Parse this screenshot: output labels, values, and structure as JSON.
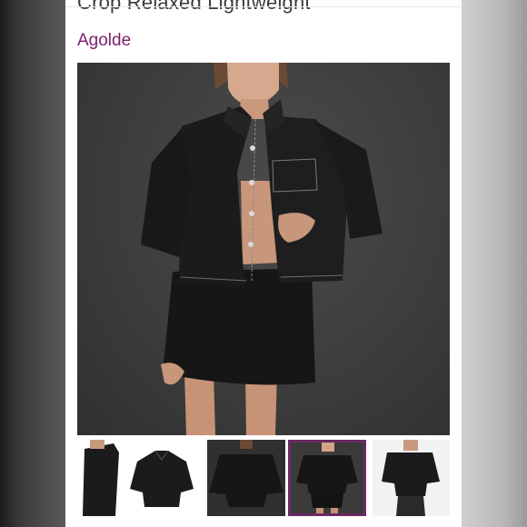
{
  "product": {
    "title": "Crop Relaxed Lightweight",
    "brand": "Agolde"
  },
  "colors": {
    "brand": "#7b1f6f",
    "active_thumb_border": "#6b2a63",
    "photo_bg": "#3c3d3c"
  },
  "gallery": {
    "main_image": "model-black-denim-shirt-and-skirt",
    "selected_index": 3,
    "thumbnails": [
      {
        "name": "model-side-view"
      },
      {
        "name": "shirt-flat-lay"
      },
      {
        "name": "model-back-view"
      },
      {
        "name": "model-front-view"
      },
      {
        "name": "model-with-jeans"
      }
    ]
  }
}
